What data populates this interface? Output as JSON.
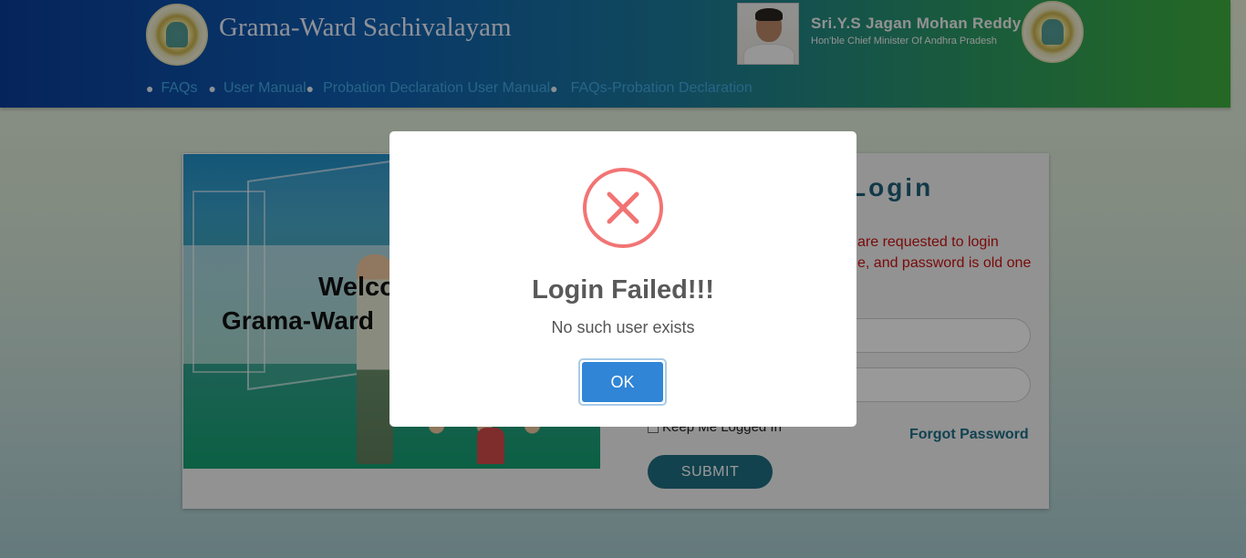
{
  "header": {
    "site_title": "Grama-Ward Sachivalayam",
    "cm_name": "Sri.Y.S Jagan Mohan Reddy",
    "cm_title": "Hon'ble Chief Minister Of Andhra Pradesh",
    "nav": [
      {
        "label": "FAQs"
      },
      {
        "label": "User Manual"
      },
      {
        "label": "Probation Declaration User Manual"
      },
      {
        "label": "FAQs-Probation Declaration"
      }
    ]
  },
  "banner": {
    "welcome_line1": "Welco",
    "welcome_line2": "Grama-Ward"
  },
  "login": {
    "title": "Login",
    "notice_line1": "are requested to login",
    "notice_line2": "e, and password is old one",
    "keep_logged_in": "Keep Me Logged In",
    "forgot_password": "Forgot Password",
    "submit": "SUBMIT"
  },
  "modal": {
    "icon": "error-x-icon",
    "title": "Login Failed!!!",
    "text": "No such user exists",
    "ok": "OK"
  },
  "colors": {
    "error_red": "#f27474",
    "ok_blue": "#3085d6",
    "submit_teal": "#1f6f80",
    "notice_red": "#cc1111"
  }
}
